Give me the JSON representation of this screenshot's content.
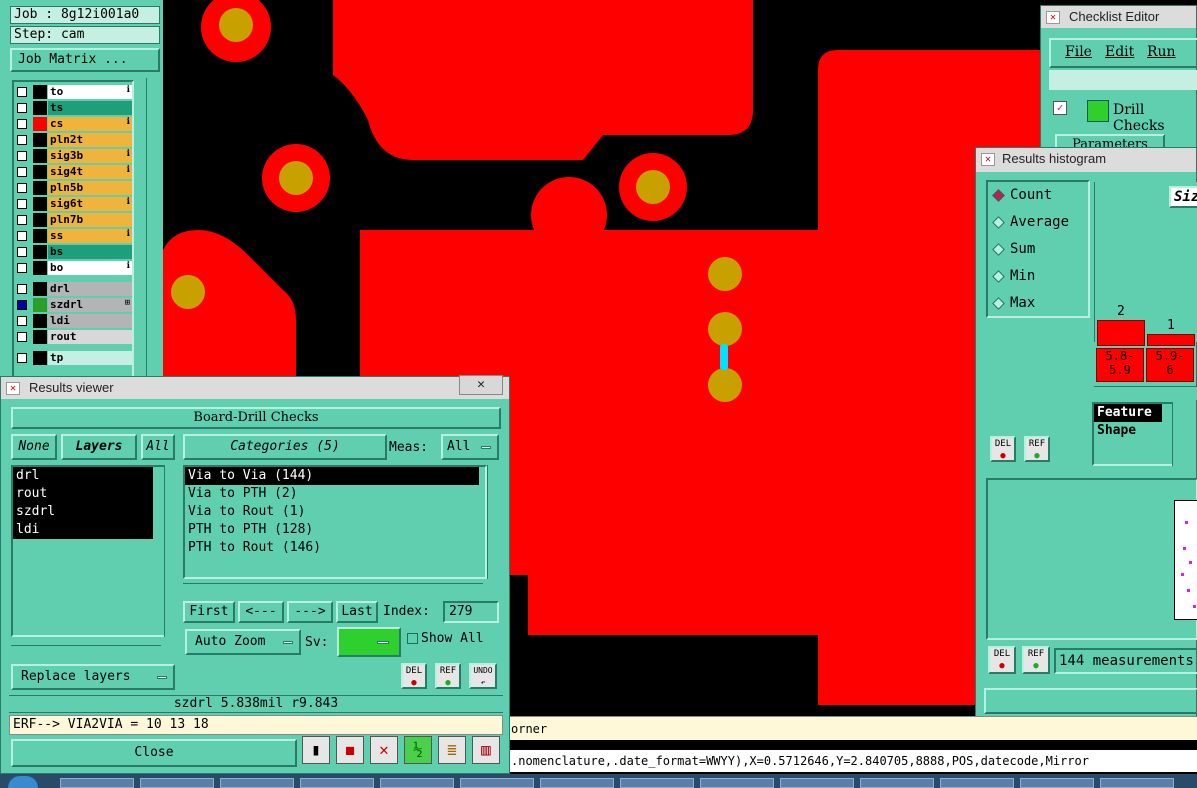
{
  "job": {
    "job_label": "Job : 8g12i001a0",
    "step_label": "Step: cam",
    "matrix_button": "Job Matrix ..."
  },
  "layers": [
    {
      "name": "to",
      "bg": "#ffffff",
      "color": "#000000",
      "flag": "ℹ"
    },
    {
      "name": "ts",
      "bg": "#1e9e7a",
      "color": "#000000",
      "flag": ""
    },
    {
      "name": "cs",
      "bg": "#f0b43c",
      "color": "#ff0000",
      "flag": "ℹ"
    },
    {
      "name": "pln2t",
      "bg": "#f0b43c",
      "color": "#000000",
      "flag": ""
    },
    {
      "name": "sig3b",
      "bg": "#f0b43c",
      "color": "#000000",
      "flag": "ℹ"
    },
    {
      "name": "sig4t",
      "bg": "#f0b43c",
      "color": "#000000",
      "flag": "ℹ"
    },
    {
      "name": "pln5b",
      "bg": "#f0b43c",
      "color": "#000000",
      "flag": ""
    },
    {
      "name": "sig6t",
      "bg": "#f0b43c",
      "color": "#000000",
      "flag": "ℹ"
    },
    {
      "name": "pln7b",
      "bg": "#f0b43c",
      "color": "#000000",
      "flag": ""
    },
    {
      "name": "ss",
      "bg": "#f0b43c",
      "color": "#000000",
      "flag": "ℹ"
    },
    {
      "name": "bs",
      "bg": "#1e9e7a",
      "color": "#000000",
      "flag": ""
    },
    {
      "name": "bo",
      "bg": "#ffffff",
      "color": "#000000",
      "flag": "ℹ"
    },
    {
      "name": "drl",
      "bg": "#b4b4b4",
      "color": "#000000",
      "flag": ""
    },
    {
      "name": "szdrl",
      "bg": "#b4b4b4",
      "color": "#2aa02a",
      "flag": "⊞"
    },
    {
      "name": "ldi",
      "bg": "#b4b4b4",
      "color": "#000000",
      "flag": ""
    },
    {
      "name": "rout",
      "bg": "#d8d8d8",
      "color": "#000000",
      "flag": ""
    },
    {
      "name": "tp",
      "bg": "#c5efe3",
      "color": "#000000",
      "flag": ""
    }
  ],
  "results_viewer": {
    "title": "Results viewer",
    "header": "Board-Drill Checks",
    "none_btn": "None",
    "layers_btn": "Layers",
    "all_btn": "All",
    "layer_list": [
      "drl",
      "rout",
      "szdrl",
      "ldi"
    ],
    "categories_btn": "Categories (5)",
    "meas_label": "Meas:",
    "meas_value": "All",
    "categories": [
      "Via to Via  (144)",
      "Via to PTH  (2)",
      "Via to Rout  (1)",
      "PTH to PTH  (128)",
      "PTH to Rout  (146)"
    ],
    "first_btn": "First",
    "prev_btn": "<---",
    "next_btn": "--->",
    "last_btn": "Last",
    "index_label": "Index:",
    "index_value": "279",
    "autozoom_value": "Auto Zoom",
    "sv_label": "Sv:",
    "show_all_label": "Show All",
    "replace_layers": "Replace layers",
    "del_label": "DEL",
    "ref_label": "REF",
    "undo_label": "UNDO",
    "info_line": "szdrl  5.838mil  r9.843",
    "erf_line": "ERF--> VIA2VIA = 10 13 18",
    "close_btn": "Close"
  },
  "checklist_editor": {
    "title": "Checklist Editor",
    "menu": [
      "File",
      "Edit",
      "Run"
    ],
    "drill_checks": "Drill Checks",
    "parameters_tab": "Parameters"
  },
  "histogram": {
    "title": "Results histogram",
    "options": [
      "Count",
      "Average",
      "Sum",
      "Min",
      "Max"
    ],
    "selected": "Count",
    "size_label": "Siz",
    "bars": [
      {
        "count": "2",
        "range": "5.8-\n5.9"
      },
      {
        "count": "1",
        "range": "5.9-\n6"
      }
    ],
    "feature_list": [
      "Feature",
      "Shape"
    ],
    "del_label": "DEL",
    "ref_label": "REF",
    "measurements": "144 measurements"
  },
  "command_line": "orner",
  "status_line": ".nomenclature,.date_format=WWYY),X=0.5712646,Y=2.840705,8888,POS,datecode,Mirror",
  "colors": {
    "panel": "#5fcfb0",
    "copper": "#ff0000",
    "pad": "#c8a000",
    "via_marker": "#00e0ff"
  }
}
